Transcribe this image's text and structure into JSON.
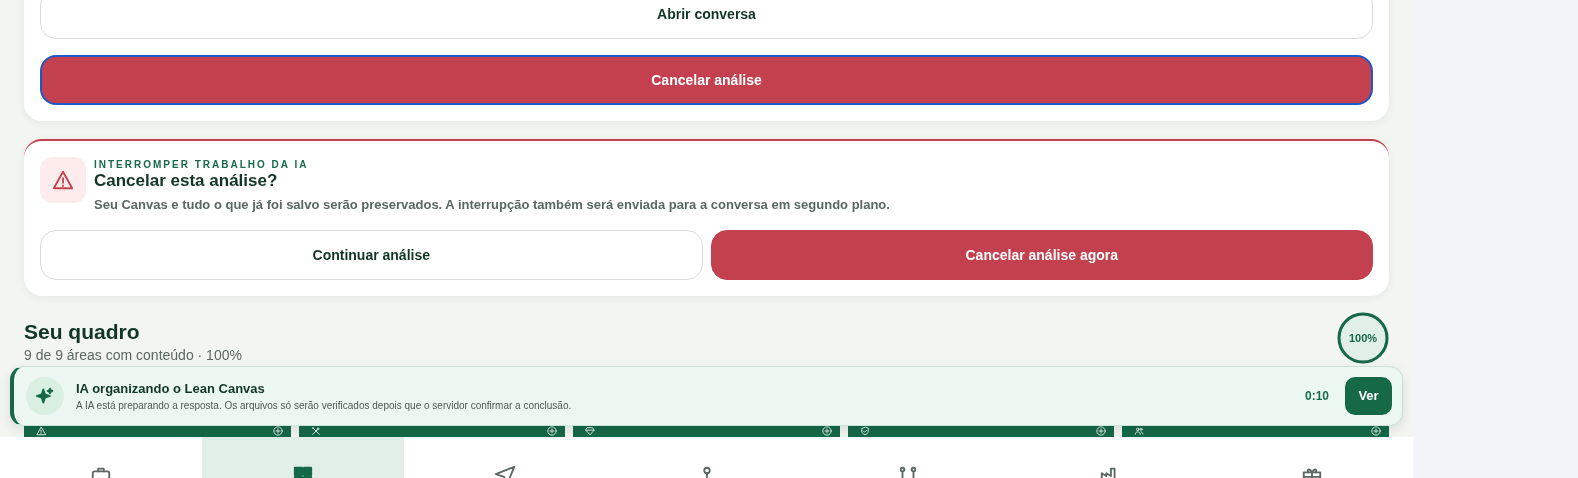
{
  "top_card": {
    "buttons": [
      {
        "label": "Abrir conversa",
        "kind": "secondary",
        "focused": false
      },
      {
        "label": "Cancelar análise",
        "kind": "danger",
        "focused": true
      }
    ]
  },
  "confirm": {
    "eyebrow": "INTERROMPER TRABALHO DA IA",
    "title": "Cancelar esta análise?",
    "message": "Seu Canvas e tudo o que já foi salvo serão preservados. A interrupção também será enviada para a conversa em segundo plano.",
    "buttons": [
      {
        "label": "Continuar análise",
        "kind": "secondary"
      },
      {
        "label": "Cancelar análise agora",
        "kind": "danger"
      }
    ]
  },
  "board": {
    "title": "Seu quadro",
    "subtitle": "9 de 9 áreas com conteúdo · 100%",
    "progress": "100%",
    "level": 1,
    "areas": [
      {
        "kind": "warning"
      },
      {
        "kind": "tools"
      },
      {
        "kind": "diamond"
      },
      {
        "kind": "shield"
      },
      {
        "kind": "users"
      }
    ]
  },
  "toast": {
    "title": "IA organizando o Lean Canvas",
    "message": "A IA está preparando a resposta. Os arquivos só serão verificados depois que o servidor confirmar a conclusão.",
    "timer": "0:10",
    "button": "Ver"
  },
  "nav": [
    {
      "kind": "briefcase",
      "selected": false
    },
    {
      "kind": "grid",
      "selected": true
    },
    {
      "kind": "send",
      "selected": false
    },
    {
      "kind": "pin",
      "selected": false
    },
    {
      "kind": "route",
      "selected": false
    },
    {
      "kind": "factory",
      "selected": false
    },
    {
      "kind": "gift",
      "selected": false
    }
  ]
}
